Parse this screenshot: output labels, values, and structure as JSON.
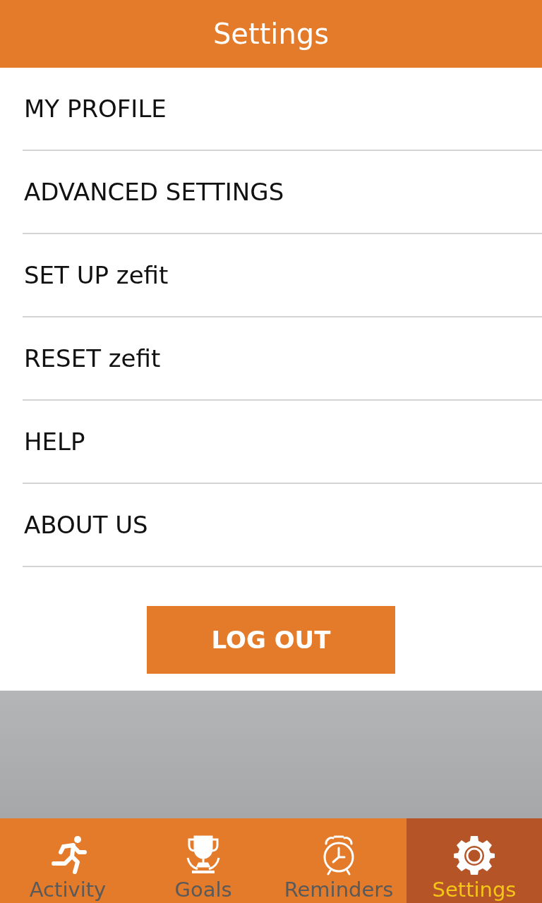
{
  "header": {
    "title": "Settings"
  },
  "menu": [
    {
      "label": "MY PROFILE"
    },
    {
      "label": "ADVANCED SETTINGS"
    },
    {
      "label": "SET UP zefit"
    },
    {
      "label": "RESET zefit"
    },
    {
      "label": "HELP"
    },
    {
      "label": "ABOUT US"
    }
  ],
  "logout_button": {
    "label": "LOG OUT"
  },
  "tabs": [
    {
      "kind": "runner",
      "label": "Activity",
      "selected": false
    },
    {
      "kind": "trophy",
      "label": "Goals",
      "selected": false
    },
    {
      "kind": "alarm",
      "label": "Reminders",
      "selected": false
    },
    {
      "kind": "gear",
      "label": "Settings",
      "selected": true
    }
  ]
}
